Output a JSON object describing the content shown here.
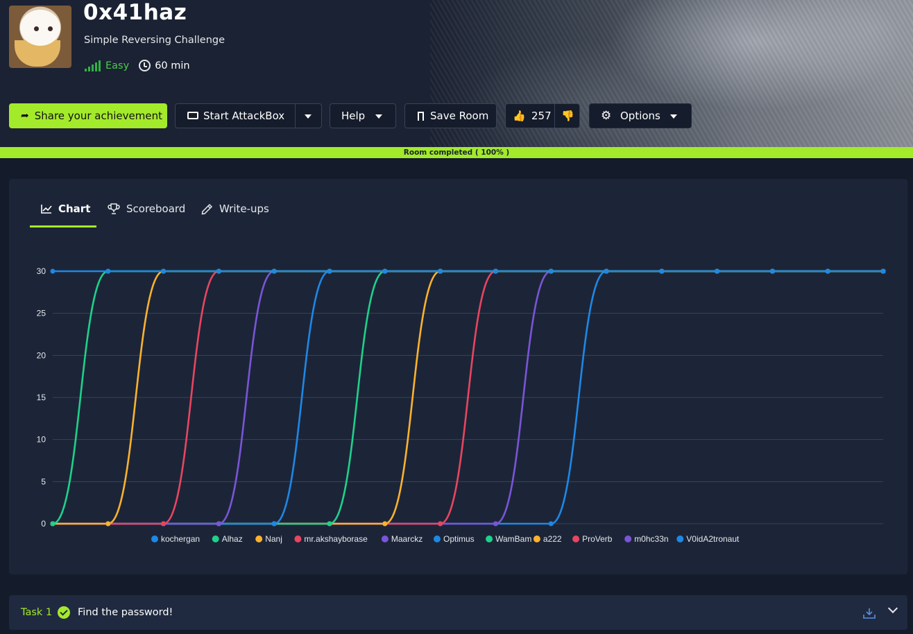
{
  "room": {
    "title": "0x41haz",
    "subtitle": "Simple Reversing Challenge",
    "difficulty": "Easy",
    "duration": "60 min"
  },
  "actions": {
    "share_label": "Share your achievement",
    "attackbox_label": "Start AttackBox",
    "help_label": "Help",
    "save_label": "Save Room",
    "likes": "257",
    "options_label": "Options"
  },
  "progress": {
    "label": "Room completed ( 100% )",
    "percent": 100
  },
  "tabs": [
    {
      "label": "Chart",
      "icon": "chart-icon",
      "active": true
    },
    {
      "label": "Scoreboard",
      "icon": "trophy-icon",
      "active": false
    },
    {
      "label": "Write-ups",
      "icon": "pencil-icon",
      "active": false
    }
  ],
  "colors": {
    "accent": "#a3ea2a",
    "blue": "#1e88e5",
    "green": "#1fd18b",
    "orange": "#fdb22e",
    "red": "#e94560",
    "purple": "#7a55d6"
  },
  "chart_data": {
    "type": "line",
    "x": [
      1,
      2,
      3,
      4,
      5,
      6,
      7,
      8,
      9,
      10,
      11,
      12,
      13,
      14,
      15,
      16
    ],
    "ylim": [
      0,
      30
    ],
    "yticks": [
      "0",
      "5",
      "10",
      "15",
      "20",
      "25",
      "30"
    ],
    "grid": true,
    "legend_position": "bottom",
    "series": [
      {
        "name": "kochergan",
        "color": "#1e88e5",
        "values": [
          30,
          30,
          30,
          30,
          30,
          30,
          30,
          30,
          30,
          30,
          30,
          30,
          30,
          30,
          30,
          30
        ]
      },
      {
        "name": "Alhaz",
        "color": "#1fd18b",
        "values": [
          0,
          30,
          30,
          30,
          30,
          30,
          30,
          30,
          30,
          30,
          30,
          30,
          30,
          30,
          30,
          30
        ]
      },
      {
        "name": "Nanj",
        "color": "#fdb22e",
        "values": [
          0,
          0,
          30,
          30,
          30,
          30,
          30,
          30,
          30,
          30,
          30,
          30,
          30,
          30,
          30,
          30
        ]
      },
      {
        "name": "mr.akshayborase",
        "color": "#e94560",
        "values": [
          0,
          0,
          0,
          30,
          30,
          30,
          30,
          30,
          30,
          30,
          30,
          30,
          30,
          30,
          30,
          30
        ]
      },
      {
        "name": "Maarckz",
        "color": "#7a55d6",
        "values": [
          0,
          0,
          0,
          0,
          30,
          30,
          30,
          30,
          30,
          30,
          30,
          30,
          30,
          30,
          30,
          30
        ]
      },
      {
        "name": "Optimus",
        "color": "#1e88e5",
        "values": [
          0,
          0,
          0,
          0,
          0,
          30,
          30,
          30,
          30,
          30,
          30,
          30,
          30,
          30,
          30,
          30
        ]
      },
      {
        "name": "WamBam",
        "color": "#1fd18b",
        "values": [
          0,
          0,
          0,
          0,
          0,
          0,
          30,
          30,
          30,
          30,
          30,
          30,
          30,
          30,
          30,
          30
        ]
      },
      {
        "name": "a222",
        "color": "#fdb22e",
        "values": [
          0,
          0,
          0,
          0,
          0,
          0,
          0,
          30,
          30,
          30,
          30,
          30,
          30,
          30,
          30,
          30
        ]
      },
      {
        "name": "ProVerb",
        "color": "#e94560",
        "values": [
          0,
          0,
          0,
          0,
          0,
          0,
          0,
          0,
          30,
          30,
          30,
          30,
          30,
          30,
          30,
          30
        ]
      },
      {
        "name": "m0hc33n",
        "color": "#7a55d6",
        "values": [
          0,
          0,
          0,
          0,
          0,
          0,
          0,
          0,
          0,
          30,
          30,
          30,
          30,
          30,
          30,
          30
        ]
      },
      {
        "name": "V0idA2tronaut",
        "color": "#1e88e5",
        "values": [
          0,
          0,
          0,
          0,
          0,
          0,
          0,
          0,
          0,
          0,
          30,
          30,
          30,
          30,
          30,
          30
        ]
      }
    ]
  },
  "task": {
    "number": "Task 1",
    "title": "Find the password!"
  }
}
